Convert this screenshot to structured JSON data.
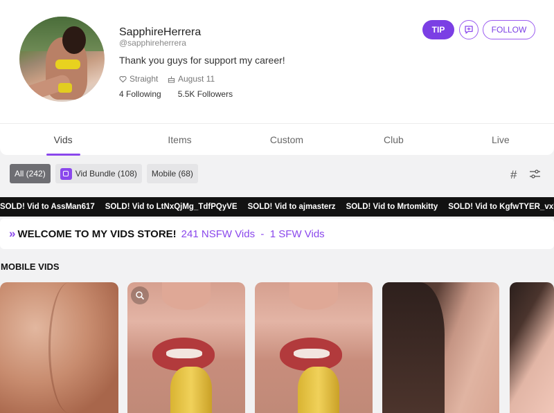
{
  "profile": {
    "username": "SapphireHerrera",
    "handle": "@sapphireherrera",
    "bio": "Thank you guys for support my career!",
    "orientation": "Straight",
    "birthday": "August 11",
    "following": "4 Following",
    "followers": "5.5K Followers"
  },
  "actions": {
    "tip_label": "TIP",
    "follow_label": "FOLLOW"
  },
  "tabs": [
    {
      "label": "Vids",
      "active": true
    },
    {
      "label": "Items",
      "active": false
    },
    {
      "label": "Custom",
      "active": false
    },
    {
      "label": "Club",
      "active": false
    },
    {
      "label": "Live",
      "active": false
    }
  ],
  "filters": [
    {
      "label": "All (242)",
      "active": true
    },
    {
      "label": "Vid Bundle (108)",
      "active": false,
      "icon": "bundle-icon"
    },
    {
      "label": "Mobile (68)",
      "active": false
    }
  ],
  "ticker": [
    "SOLD! Vid to AssMan617",
    "SOLD! Vid to LtNxQjMg_TdfPQyVE",
    "SOLD! Vid to ajmasterz",
    "SOLD! Vid to Mrtomkitty",
    "SOLD! Vid to KgfwTYER_vxFWB"
  ],
  "welcome": {
    "title": "WELCOME TO MY VIDS STORE!",
    "counts": "241 NSFW Vids  -  1 SFW Vids"
  },
  "section": {
    "title": "MOBILE VIDS"
  },
  "colors": {
    "accent": "#8a47ec",
    "tip": "#7b3fe4",
    "ticker_bg": "#121212"
  }
}
